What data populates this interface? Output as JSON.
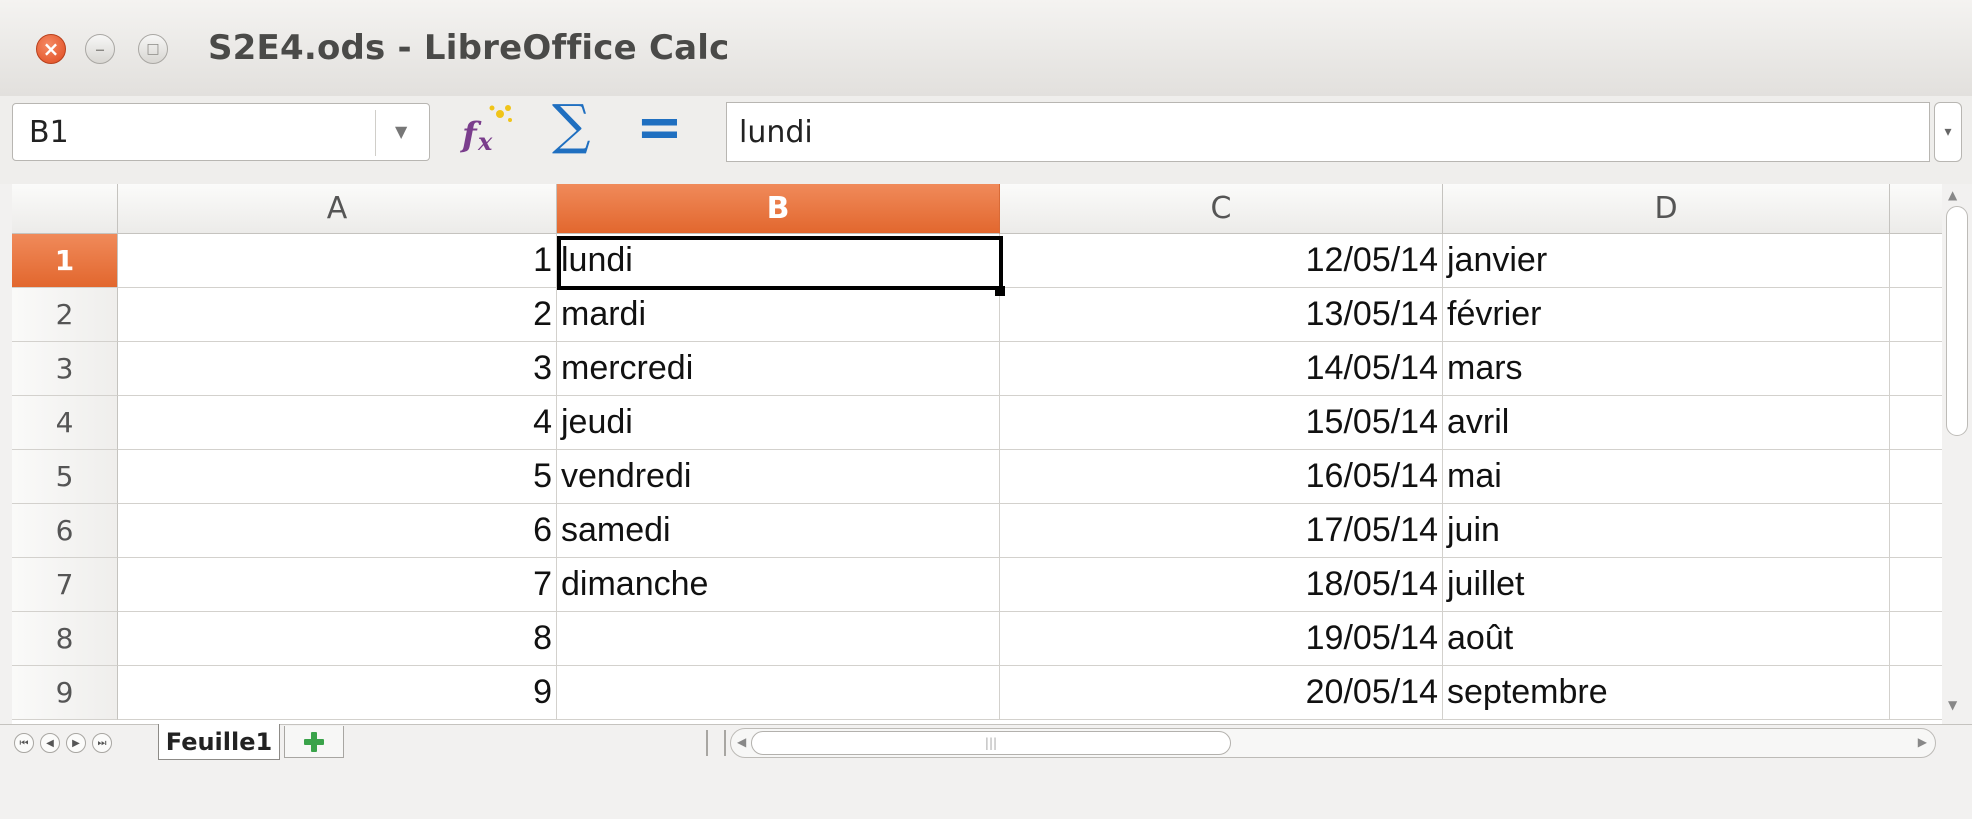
{
  "window": {
    "title": "S2E4.ods - LibreOffice Calc",
    "close_glyph": "×",
    "minimize_glyph": "–",
    "maximize_glyph": "□"
  },
  "formula_bar": {
    "name_box": "B1",
    "name_box_arrow": "▼",
    "function_wizard_icon": "function-wizard-icon",
    "sum_glyph": "∑",
    "equals_glyph": "=",
    "formula_value": "lundi",
    "expand_glyph": "▾"
  },
  "columns": [
    "A",
    "B",
    "C",
    "D"
  ],
  "selected_column": "B",
  "selected_row": 1,
  "rows": [
    {
      "row": "1",
      "a": "1",
      "b": "lundi",
      "c": "12/05/14",
      "d": "janvier"
    },
    {
      "row": "2",
      "a": "2",
      "b": "mardi",
      "c": "13/05/14",
      "d": "février"
    },
    {
      "row": "3",
      "a": "3",
      "b": "mercredi",
      "c": "14/05/14",
      "d": "mars"
    },
    {
      "row": "4",
      "a": "4",
      "b": "jeudi",
      "c": "15/05/14",
      "d": "avril"
    },
    {
      "row": "5",
      "a": "5",
      "b": "vendredi",
      "c": "16/05/14",
      "d": "mai"
    },
    {
      "row": "6",
      "a": "6",
      "b": "samedi",
      "c": "17/05/14",
      "d": "juin"
    },
    {
      "row": "7",
      "a": "7",
      "b": "dimanche",
      "c": "18/05/14",
      "d": "juillet"
    },
    {
      "row": "8",
      "a": "8",
      "b": "",
      "c": "19/05/14",
      "d": "août"
    },
    {
      "row": "9",
      "a": "9",
      "b": "",
      "c": "20/05/14",
      "d": "septembre"
    }
  ],
  "sheet_nav": {
    "first": "⏮",
    "prev": "◀",
    "next": "▶",
    "last": "⏭"
  },
  "sheet_tabs": [
    {
      "label": "Feuille1",
      "active": true
    }
  ],
  "colors": {
    "selection_header": "#e8743e",
    "accent_icon": "#1f6fc0"
  }
}
